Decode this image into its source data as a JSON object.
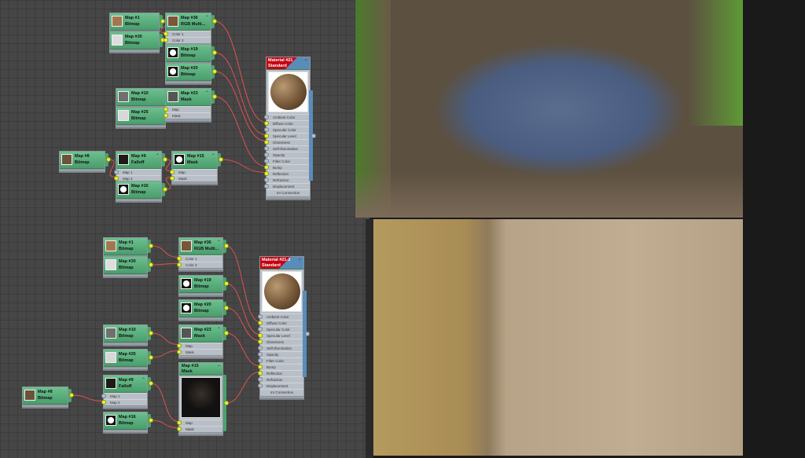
{
  "graphs": [
    {
      "nodes": [
        {
          "id": "n1",
          "title": "Map #1",
          "type": "Bitmap",
          "slots": []
        },
        {
          "id": "n30",
          "title": "Map #30",
          "type": "Bitmap",
          "slots": []
        },
        {
          "id": "n36",
          "title": "Map #36",
          "type": "RGB Multi...",
          "slots": [
            {
              "label": "Color 1",
              "connected": true
            },
            {
              "label": "Color 2",
              "connected": true
            }
          ]
        },
        {
          "id": "n19",
          "title": "Map #19",
          "type": "Bitmap",
          "slots": []
        },
        {
          "id": "n20",
          "title": "Map #20",
          "type": "Bitmap",
          "slots": []
        },
        {
          "id": "n10",
          "title": "Map #10",
          "type": "Bitmap",
          "slots": []
        },
        {
          "id": "n25",
          "title": "Map #25",
          "type": "Bitmap",
          "slots": []
        },
        {
          "id": "n23",
          "title": "Map #23",
          "type": "Mask",
          "slots": [
            {
              "label": "Map",
              "connected": true
            },
            {
              "label": "Mask",
              "connected": true
            }
          ]
        },
        {
          "id": "n8",
          "title": "Map #8",
          "type": "Bitmap",
          "slots": []
        },
        {
          "id": "n9",
          "title": "Map #9",
          "type": "Falloff",
          "slots": [
            {
              "label": "Map 1",
              "connected": false
            },
            {
              "label": "Map 2",
              "connected": true
            }
          ]
        },
        {
          "id": "n16",
          "title": "Map #16",
          "type": "Bitmap",
          "slots": []
        },
        {
          "id": "n15",
          "title": "Map #15",
          "type": "Mask",
          "slots": [
            {
              "label": "Map",
              "connected": true
            },
            {
              "label": "Mask",
              "connected": true
            }
          ]
        }
      ],
      "material": {
        "title": "Material #21",
        "type": "Standard",
        "footer": "mr Connection"
      },
      "connections": [
        [
          "n1",
          "n36",
          0
        ],
        [
          "n30",
          "n36",
          1
        ],
        [
          "n10",
          "n23",
          0
        ],
        [
          "n25",
          "n23",
          1
        ],
        [
          "n8",
          "n9",
          1
        ],
        [
          "n9",
          "n15",
          0
        ],
        [
          "n16",
          "n15",
          1
        ],
        [
          "n36",
          "mat",
          1
        ],
        [
          "n19",
          "mat",
          3
        ],
        [
          "n20",
          "mat",
          4
        ],
        [
          "n23",
          "mat",
          8
        ],
        [
          "n15",
          "mat",
          9
        ]
      ]
    },
    {
      "nodes": [
        {
          "id": "n1",
          "title": "Map #1",
          "type": "Bitmap",
          "slots": []
        },
        {
          "id": "n30",
          "title": "Map #30",
          "type": "Bitmap",
          "slots": []
        },
        {
          "id": "n36",
          "title": "Map #36",
          "type": "RGB Multi...",
          "slots": [
            {
              "label": "Color 1",
              "connected": true
            },
            {
              "label": "Color 2",
              "connected": true
            }
          ]
        },
        {
          "id": "n19",
          "title": "Map #19",
          "type": "Bitmap",
          "slots": []
        },
        {
          "id": "n20",
          "title": "Map #20",
          "type": "Bitmap",
          "slots": []
        },
        {
          "id": "n10",
          "title": "Map #10",
          "type": "Bitmap",
          "slots": []
        },
        {
          "id": "n25",
          "title": "Map #25",
          "type": "Bitmap",
          "slots": []
        },
        {
          "id": "n23",
          "title": "Map #23",
          "type": "Mask",
          "slots": [
            {
              "label": "Map",
              "connected": true
            },
            {
              "label": "Mask",
              "connected": true
            }
          ]
        },
        {
          "id": "n8",
          "title": "Map #8",
          "type": "Bitmap",
          "slots": []
        },
        {
          "id": "n9",
          "title": "Map #9",
          "type": "Falloff",
          "slots": [
            {
              "label": "Map 1",
              "connected": false
            },
            {
              "label": "Map 2",
              "connected": true
            }
          ]
        },
        {
          "id": "n16",
          "title": "Map #16",
          "type": "Bitmap",
          "slots": []
        },
        {
          "id": "n15",
          "title": "Map #15",
          "type": "Mask",
          "slots": [
            {
              "label": "Map",
              "connected": true
            },
            {
              "label": "Mask",
              "connected": true
            }
          ]
        }
      ],
      "material": {
        "title": "Material #21-2",
        "type": "Standard",
        "footer": "mr Connection"
      },
      "connections": [
        [
          "n1",
          "n36",
          0
        ],
        [
          "n30",
          "n36",
          1
        ],
        [
          "n10",
          "n23",
          0
        ],
        [
          "n25",
          "n23",
          1
        ],
        [
          "n8",
          "n9",
          1
        ],
        [
          "n9",
          "n15",
          0
        ],
        [
          "n16",
          "n15",
          1
        ],
        [
          "n36",
          "mat",
          1
        ],
        [
          "n19",
          "mat",
          3
        ],
        [
          "n20",
          "mat",
          4
        ],
        [
          "n23",
          "mat",
          8
        ],
        [
          "n15",
          "mat",
          9
        ]
      ]
    }
  ],
  "material_slots": [
    {
      "label": "Ambient Color"
    },
    {
      "label": "Diffuse Color"
    },
    {
      "label": "Specular Color"
    },
    {
      "label": "Specular Level"
    },
    {
      "label": "Glossiness"
    },
    {
      "label": "Self-Illumination"
    },
    {
      "label": "Opacity"
    },
    {
      "label": "Filter Color"
    },
    {
      "label": "Bump"
    },
    {
      "label": "Reflection"
    },
    {
      "label": "Refraction"
    },
    {
      "label": "Displacement"
    }
  ],
  "colors": {
    "wire": "#e0504f",
    "port": "#e5f53a",
    "node": "#5cb07f"
  }
}
